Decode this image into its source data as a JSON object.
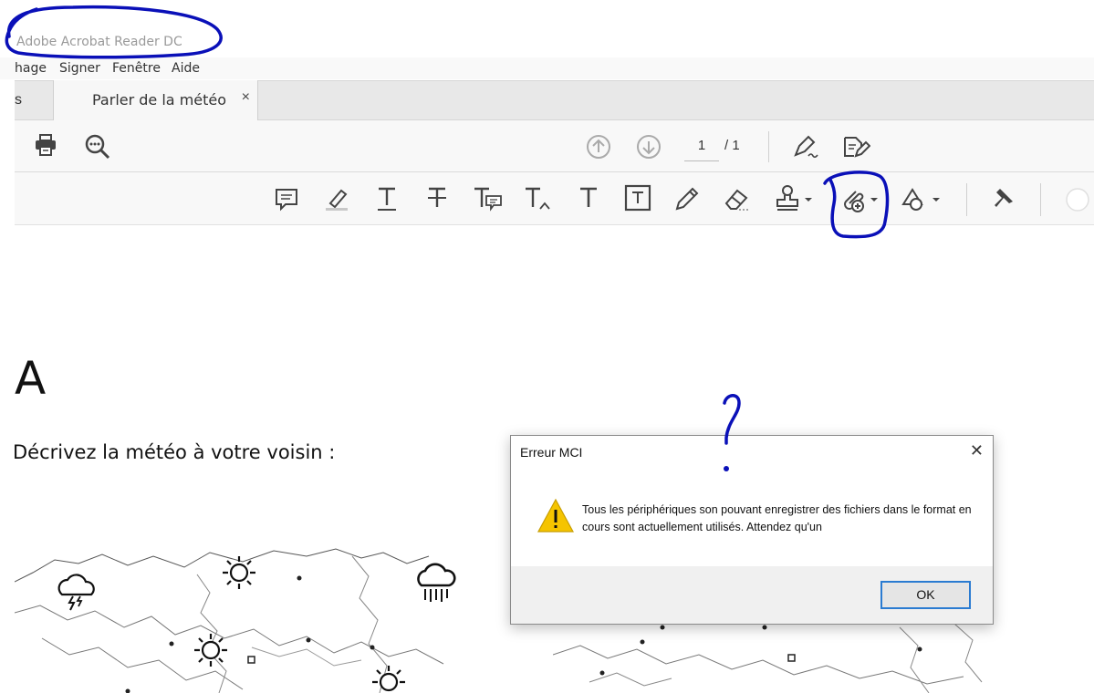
{
  "app": {
    "title": "Adobe Acrobat Reader DC",
    "menu": [
      "hage",
      "Signer",
      "Fenêtre",
      "Aide"
    ]
  },
  "tabs": {
    "previous_fragment": "s",
    "active_label": "Parler de la météo",
    "close_glyph": "×"
  },
  "toolbar": {
    "page_current": "1",
    "page_total": "/ 1",
    "icons": [
      "print-icon",
      "zoom-search-icon",
      "page-up-icon",
      "page-down-icon",
      "sign-pen-icon",
      "export-edit-icon"
    ]
  },
  "comment_toolbar": {
    "icons": [
      "comment-icon",
      "highlight-icon",
      "underline-text-icon",
      "strikethrough-text-icon",
      "replace-text-icon",
      "insert-text-icon",
      "add-text-icon",
      "text-box-icon",
      "pencil-icon",
      "eraser-icon",
      "stamp-icon",
      "attach-file-icon",
      "shapes-icon",
      "pin-icon"
    ]
  },
  "document": {
    "heading_letter": "A",
    "prompt": "Décrivez la météo à votre voisin :"
  },
  "dialog": {
    "title": "Erreur MCI",
    "close_glyph": "✕",
    "message": "Tous les périphériques son pouvant enregistrer des fichiers dans le format en cours sont actuellement utilisés. Attendez qu'un",
    "ok_label": "OK"
  },
  "colors": {
    "ink": "#0a10b8",
    "warning": "#f5c400",
    "ok_border": "#2a7bd1"
  }
}
